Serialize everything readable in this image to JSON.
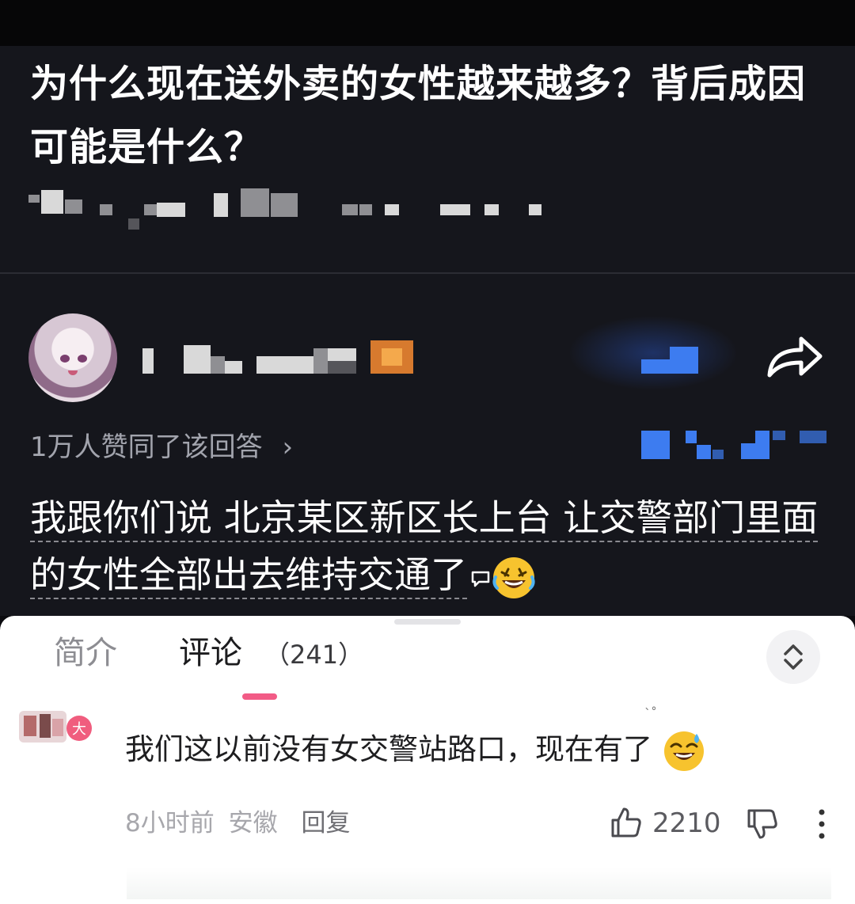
{
  "question": {
    "title": "为什么现在送外卖的女性越来越多？背后成因可能是什么？"
  },
  "answer": {
    "agree_text": "1万人赞同了该回答",
    "agree_chevron": "›",
    "text": "我跟你们说 北京某区新区长上台 让交警部门里面的女性全部出去维持交通了",
    "emoji": "🤣",
    "share_icon": "share-arrow-icon"
  },
  "tabs": {
    "intro": "简介",
    "comments": "评论",
    "comments_count": "（241）"
  },
  "comment": {
    "text": "我们这以前没有女交警站路口，现在有了",
    "emoji": "😅",
    "time": "8小时前",
    "location": "安徽",
    "reply": "回复",
    "likes": "2210",
    "avatar_badge": "大"
  },
  "colors": {
    "accent": "#f25b86",
    "blue": "#3d7cf0",
    "dark_bg": "#15161c"
  }
}
